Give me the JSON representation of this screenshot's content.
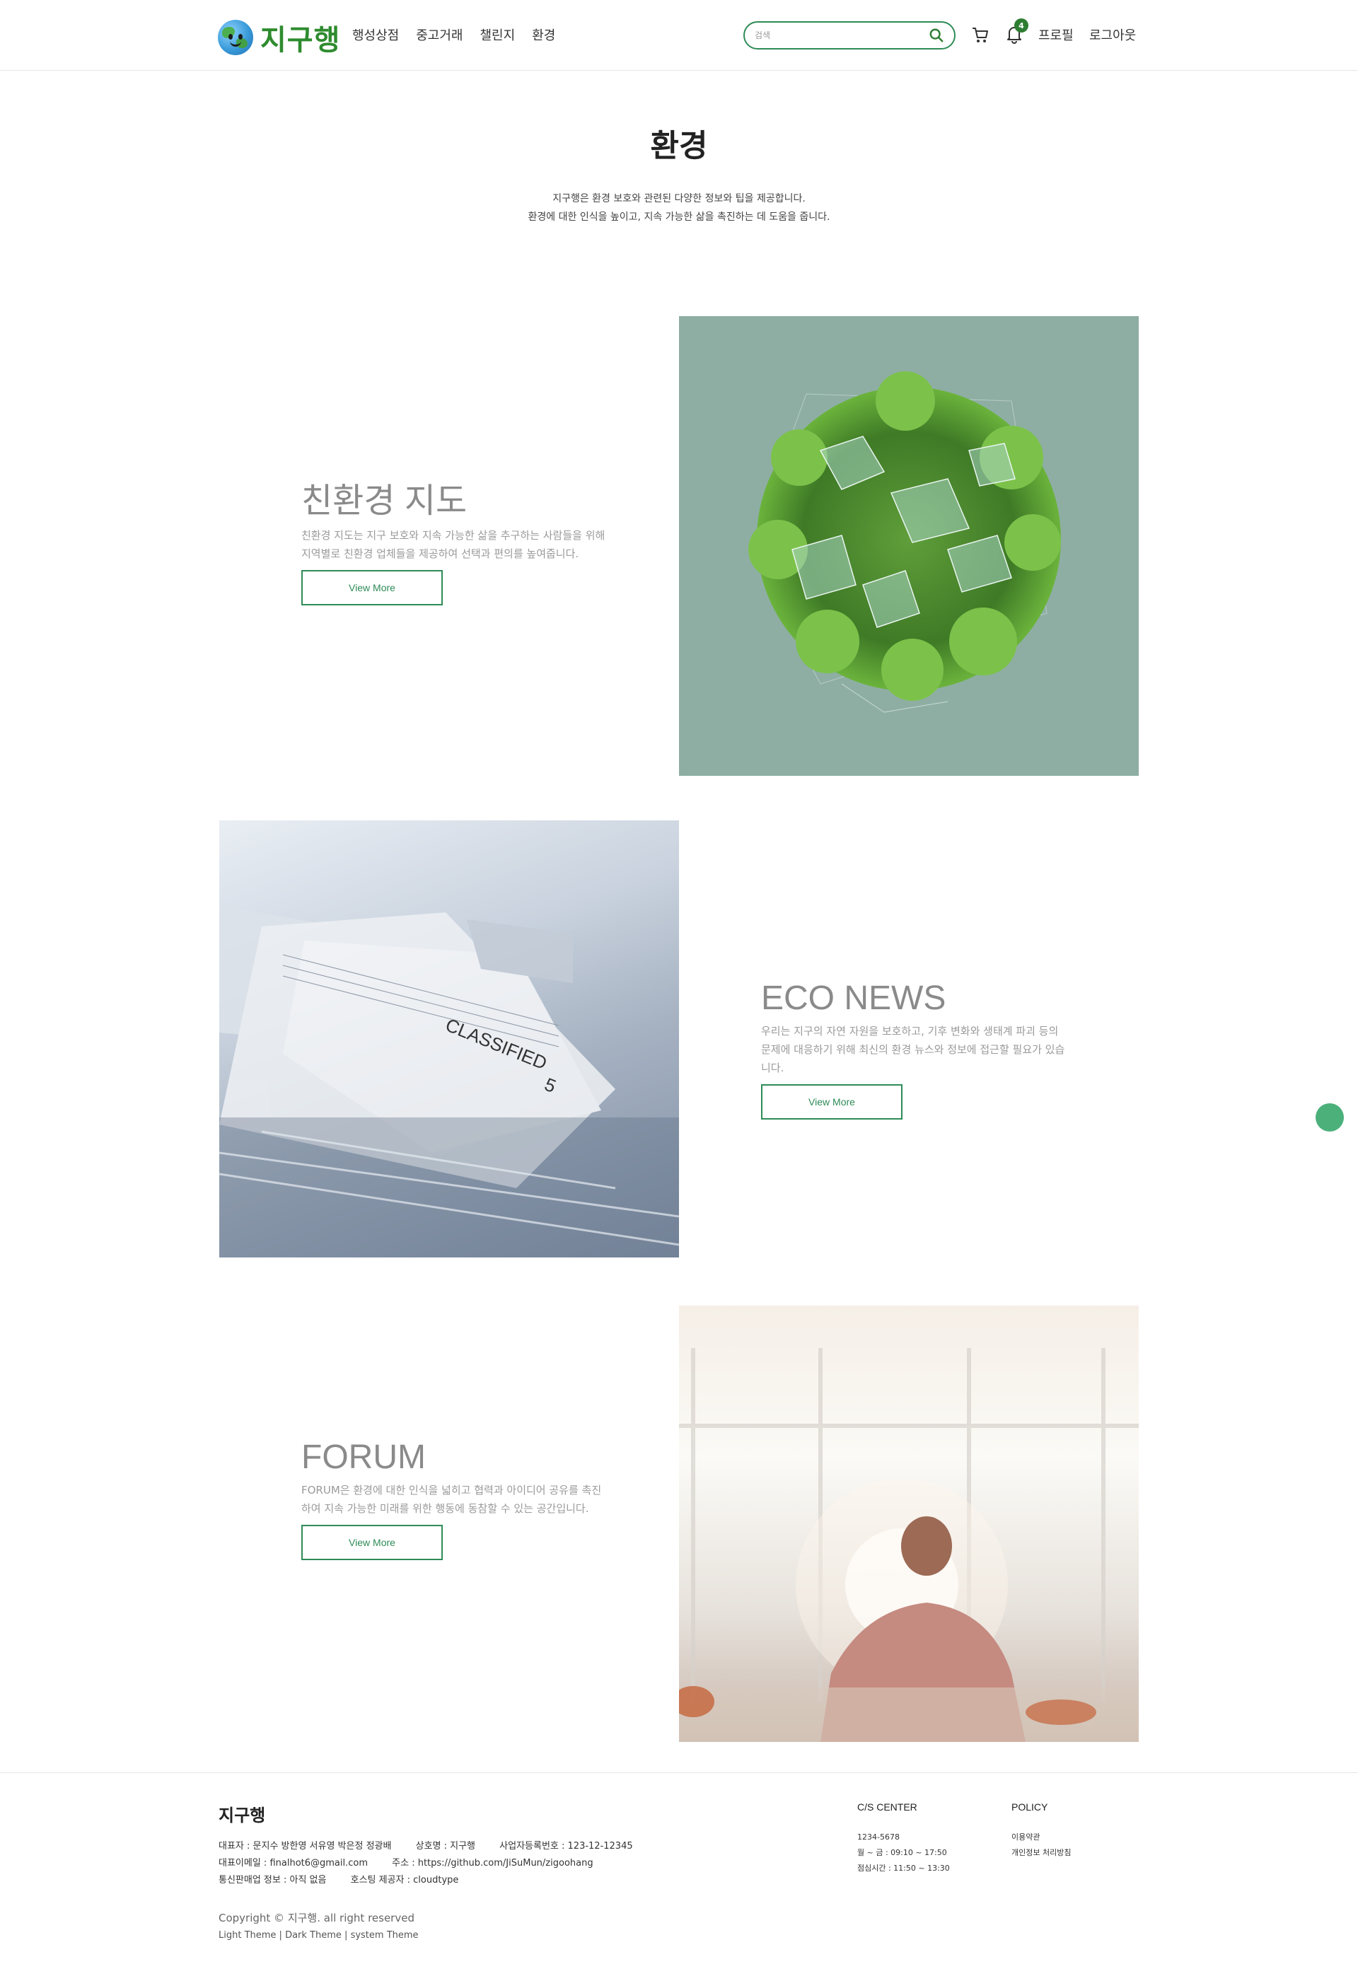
{
  "header": {
    "logo_text": "지구행",
    "nav": [
      "행성상점",
      "중고거래",
      "챌린지",
      "환경"
    ],
    "search_placeholder": "검색",
    "notification_count": "4",
    "profile_label": "프로필",
    "logout_label": "로그아웃"
  },
  "hero": {
    "title": "환경",
    "sub1": "지구행은 환경 보호와 관련된 다양한 정보와 팁을 제공합니다.",
    "sub2": "환경에 대한 인식을 높이고, 지속 가능한 삶을 촉진하는 데 도움을 줍니다."
  },
  "sections": [
    {
      "title": "친환경 지도",
      "desc": "친환경 지도는 지구 보호와 지속 가능한 삶을 추구하는 사람들을 위해 지역별로 친환경 업체들을 제공하여 선택과 편의를 높여줍니다.",
      "button": "View More"
    },
    {
      "title": "ECO NEWS",
      "desc": "우리는 지구의 자연 자원을 보호하고, 기후 변화와 생태계 파괴 등의 문제에 대응하기 위해 최신의 환경 뉴스와 정보에 접근할 필요가 있습니다.",
      "button": "View More"
    },
    {
      "title": "FORUM",
      "desc": "FORUM은 환경에 대한 인식을 넓히고 협력과 아이디어 공유를 촉진하여 지속 가능한 미래를 위한 행동에 동참할 수 있는 공간입니다.",
      "button": "View More"
    }
  ],
  "images": {
    "news_paper_text": "CLASSIFIED",
    "news_paper_number": "5"
  },
  "footer": {
    "logo": "지구행",
    "ceo": "대표자 : 문지수 방한영 서유영 박은정 정광배",
    "company": "상호명 : 지구행",
    "biz_no": "사업자등록번호 : 123-12-12345",
    "email": "대표이메일 : finalhot6@gmail.com",
    "address": "주소 : https://github.com/JiSuMun/zigoohang",
    "telecom": "통신판매업 정보 : 아직 없음",
    "hosting": "호스팅 제공자 : cloudtype",
    "copyright": "Copyright © 지구행. all right reserved",
    "themes": [
      "Light Theme",
      "Dark Theme",
      "system Theme"
    ],
    "cs": {
      "title": "C/S CENTER",
      "phone": "1234-5678",
      "hours": "월 ~ 금 : 09:10 ~ 17:50",
      "lunch": "점심시간 : 11:50 ~ 13:30"
    },
    "policy": {
      "title": "POLICY",
      "terms": "이용약관",
      "privacy": "개인정보 처리방침"
    }
  }
}
